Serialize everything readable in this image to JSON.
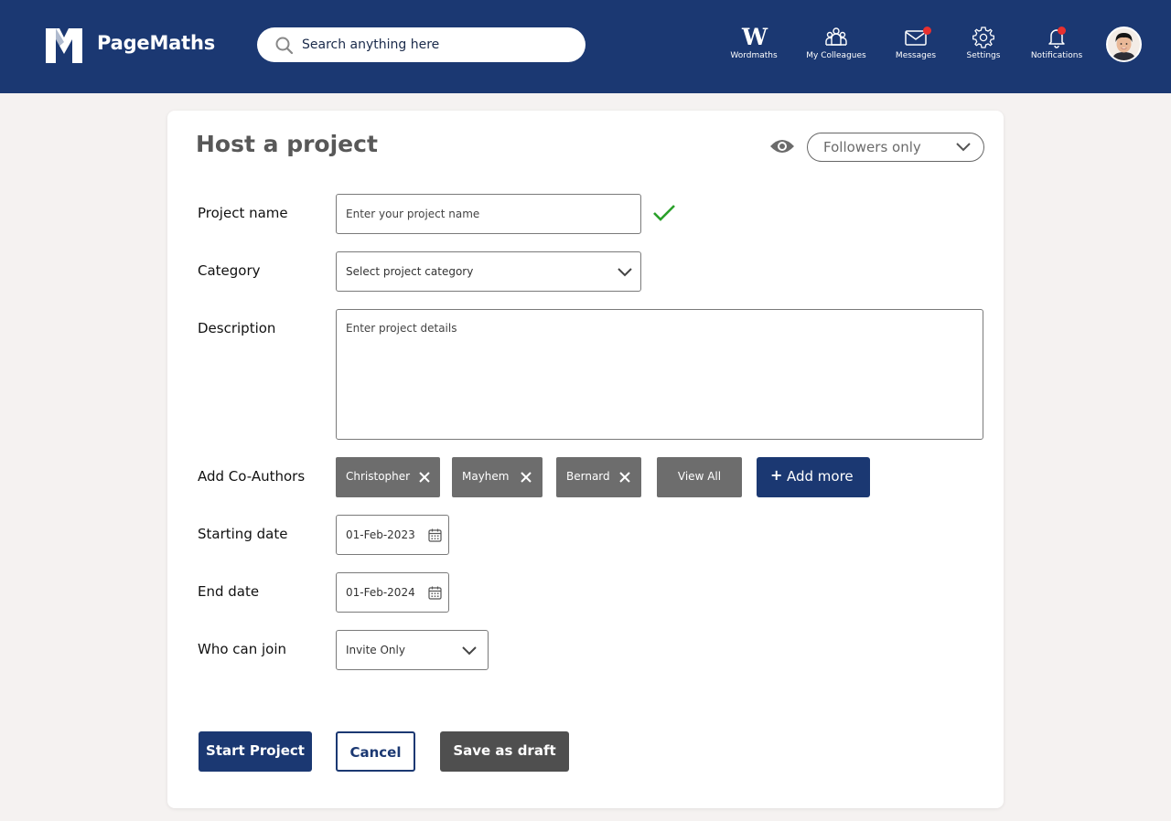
{
  "header": {
    "brand": "PageMaths",
    "search_placeholder": "Search anything here",
    "nav": {
      "wordmaths": "Wordmaths",
      "wordmaths_glyph": "W",
      "colleagues": "My Colleagues",
      "messages": "Messages",
      "settings": "Settings",
      "notifications": "Notifications"
    },
    "colors": {
      "bar": "#1b3872",
      "badge": "#e8302f"
    }
  },
  "form": {
    "title": "Host a project",
    "visibility": "Followers only",
    "project_name": {
      "label": "Project name",
      "placeholder": "Enter your project name"
    },
    "category": {
      "label": "Category",
      "value": "Select project category"
    },
    "description": {
      "label": "Description",
      "placeholder": "Enter project details"
    },
    "coauthors": {
      "label": "Add Co-Authors",
      "chips": [
        "Christopher",
        "Mayhem",
        "Bernard"
      ],
      "view_all": "View All",
      "add_more": "Add more",
      "add_symbol": "+"
    },
    "start_date": {
      "label": "Starting date",
      "value": "01-Feb-2023"
    },
    "end_date": {
      "label": "End date",
      "value": "01-Feb-2024"
    },
    "who_can_join": {
      "label": "Who can join",
      "value": "Invite Only"
    },
    "actions": {
      "start": "Start Project",
      "cancel": "Cancel",
      "draft": "Save as draft"
    }
  }
}
